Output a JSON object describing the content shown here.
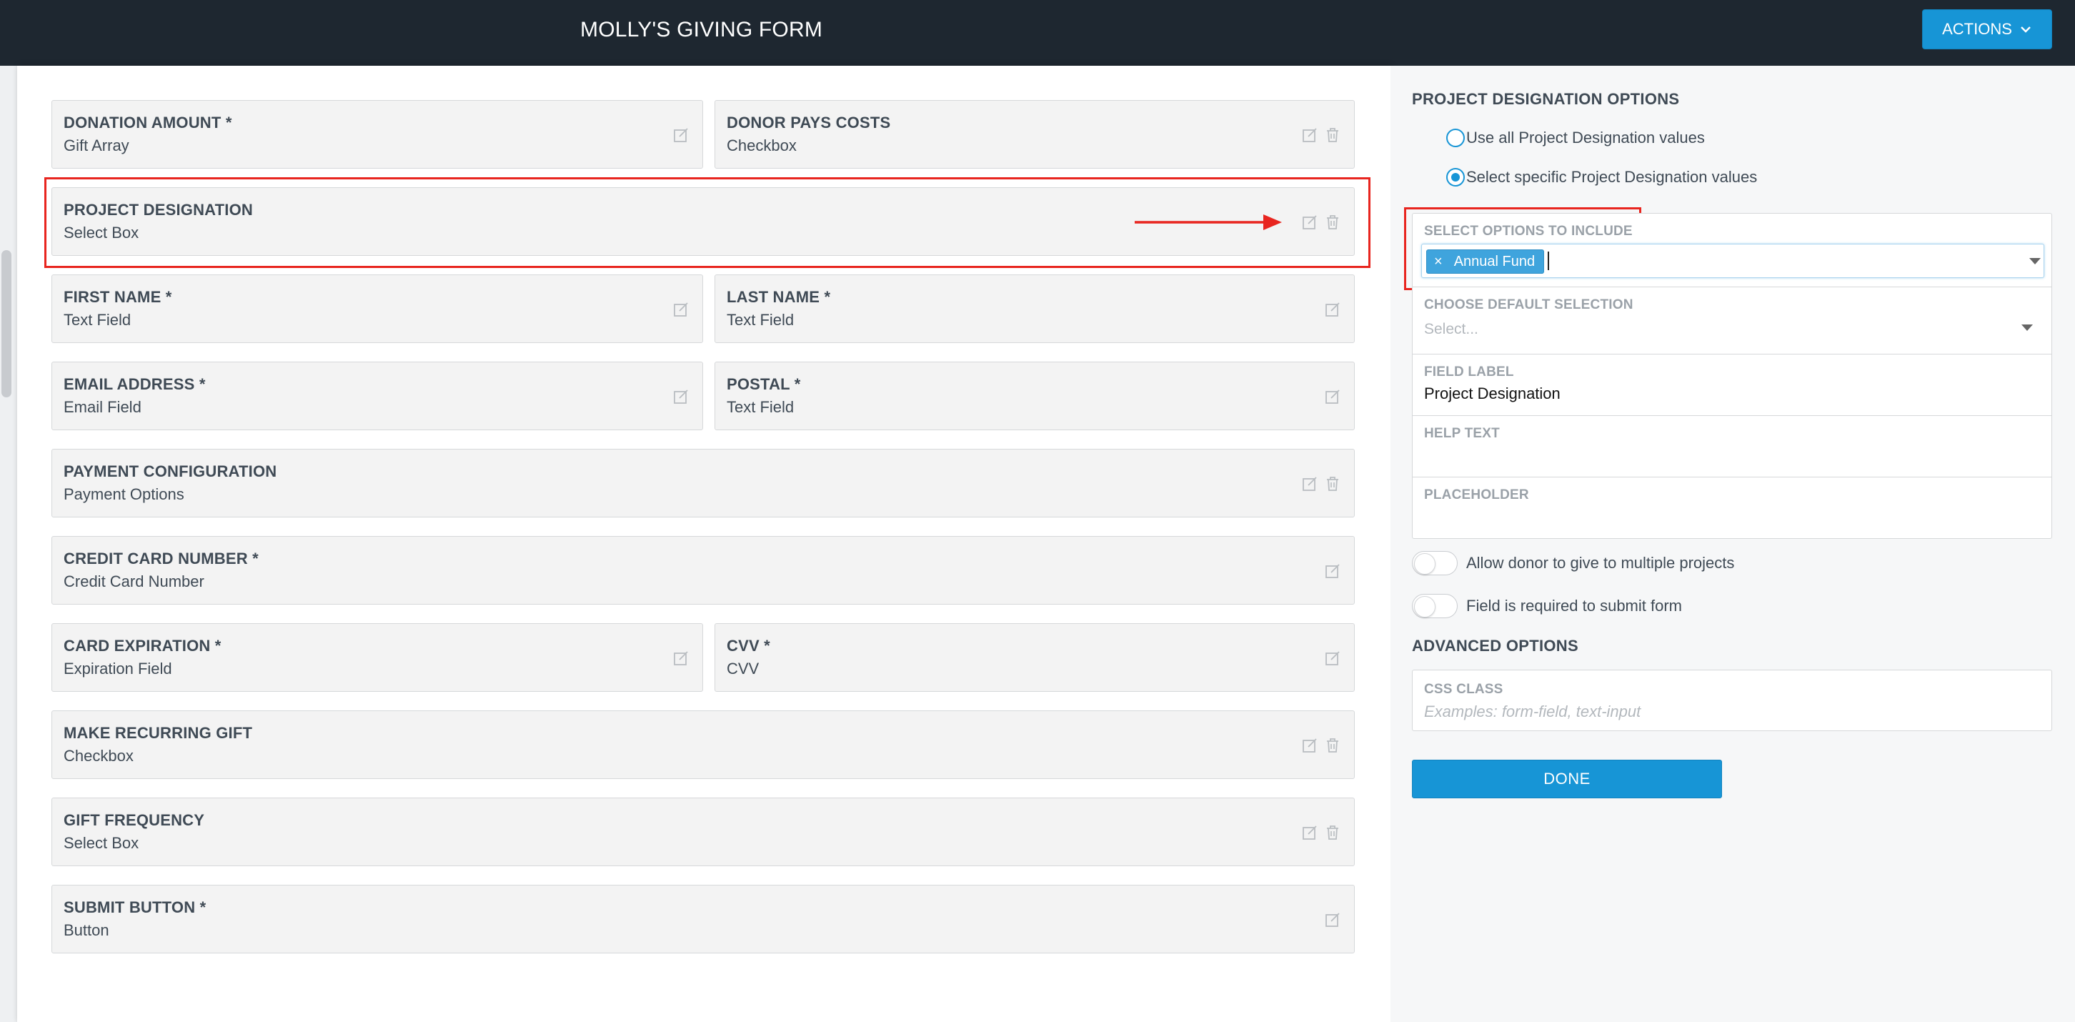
{
  "header": {
    "title": "MOLLY'S GIVING FORM",
    "actions_label": "ACTIONS",
    "actions_icon": "chevron-down-icon"
  },
  "form_fields": [
    {
      "name": "DONATION AMOUNT *",
      "type": "Gift Array",
      "has_delete": false
    },
    {
      "name": "DONOR PAYS COSTS",
      "type": "Checkbox",
      "has_delete": true
    },
    {
      "name": "PROJECT DESIGNATION",
      "type": "Select Box",
      "has_delete": true
    },
    {
      "name": "FIRST NAME *",
      "type": "Text Field",
      "has_delete": false
    },
    {
      "name": "LAST NAME *",
      "type": "Text Field",
      "has_delete": false
    },
    {
      "name": "EMAIL ADDRESS *",
      "type": "Email Field",
      "has_delete": false
    },
    {
      "name": "POSTAL *",
      "type": "Text Field",
      "has_delete": false
    },
    {
      "name": "PAYMENT CONFIGURATION",
      "type": "Payment Options",
      "has_delete": true
    },
    {
      "name": "CREDIT CARD NUMBER *",
      "type": "Credit Card Number",
      "has_delete": false
    },
    {
      "name": "CARD EXPIRATION *",
      "type": "Expiration Field",
      "has_delete": false
    },
    {
      "name": "CVV *",
      "type": "CVV",
      "has_delete": false
    },
    {
      "name": "MAKE RECURRING GIFT",
      "type": "Checkbox",
      "has_delete": true
    },
    {
      "name": "GIFT FREQUENCY",
      "type": "Select Box",
      "has_delete": true
    },
    {
      "name": "SUBMIT BUTTON *",
      "type": "Button",
      "has_delete": false
    }
  ],
  "settings": {
    "heading": "PROJECT DESIGNATION OPTIONS",
    "radio_all": "Use all Project Designation values",
    "radio_specific": "Select specific Project Designation values",
    "selected_radio": "specific",
    "select_options_label": "SELECT OPTIONS TO INCLUDE",
    "selected_tags": [
      "Annual Fund"
    ],
    "tag_remove": "×",
    "default_selection_label": "CHOOSE DEFAULT SELECTION",
    "default_selection_placeholder": "Select...",
    "field_label_label": "FIELD LABEL",
    "field_label_value": "Project Designation",
    "help_text_label": "HELP TEXT",
    "help_text_value": "",
    "placeholder_label": "PLACEHOLDER",
    "placeholder_value": "",
    "toggle_multiple": "Allow donor to give to multiple projects",
    "toggle_multiple_on": false,
    "toggle_required": "Field is required to submit form",
    "toggle_required_on": false,
    "advanced_heading": "ADVANCED OPTIONS",
    "css_class_label": "CSS CLASS",
    "css_class_placeholder": "Examples: form-field, text-input",
    "done_label": "DONE"
  },
  "colors": {
    "topbar": "#1e2730",
    "accent": "#1795d6",
    "highlight": "#e8251f"
  }
}
